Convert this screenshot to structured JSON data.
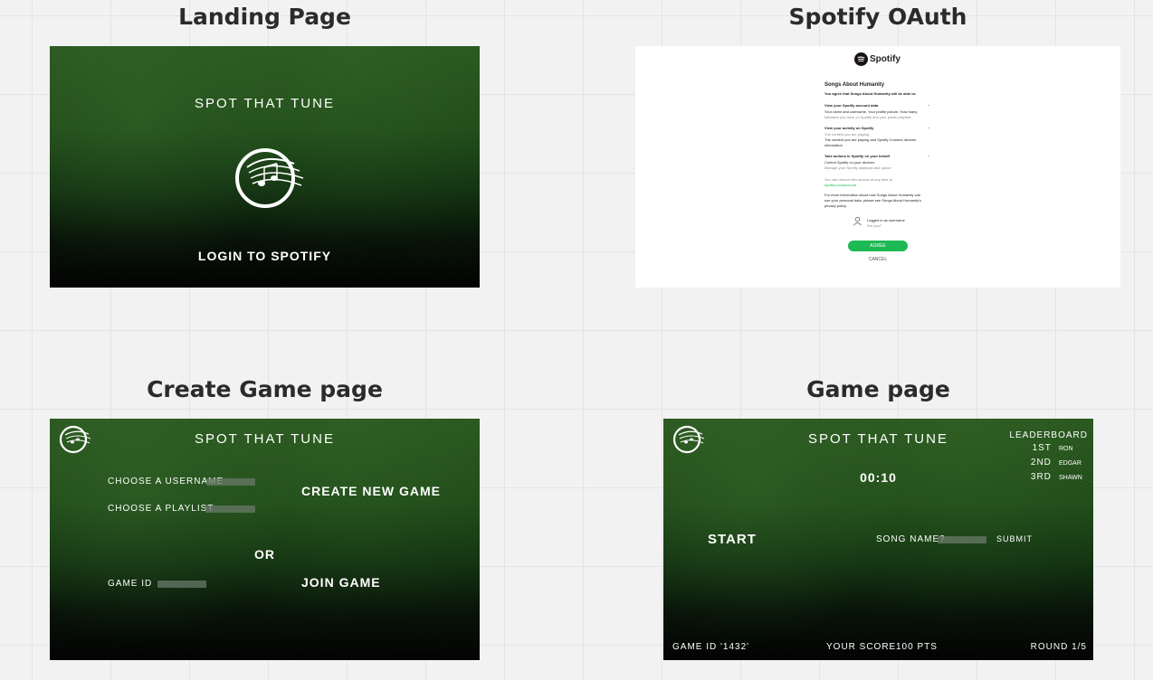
{
  "frames": {
    "landing": {
      "title": "Landing Page",
      "brand": "SPOT THAT TUNE",
      "login": "LOGIN TO SPOTIFY"
    },
    "oauth": {
      "title": "Spotify OAuth",
      "brand": "Spotify",
      "app_name": "Songs About Humanity",
      "intro": "You agree that Songs About Humanity will be able to:",
      "section1_title": "View your Spotify account data",
      "section1_l1": "Your name and username, Your profile picture, How many",
      "section1_l2": "followers you have on Spotify and your public playlists",
      "section2_title": "View your activity on Spotify",
      "section2_l1": "The content you are playing",
      "section2_l2": "The content you are playing and Spotify Connect devices",
      "section2_l3": "information",
      "section3_title": "Take actions in Spotify on your behalf",
      "section3_l1": "Control Spotify on your devices",
      "section3_l2": "Manage your Spotify playback and queue",
      "remove_l1": "You can remove this access at any time at",
      "remove_link": "spotify.com/account",
      "more_l1": "For more information about how Songs About Humanity can",
      "more_l2": "use your personal data, please see Songs About Humanity's",
      "more_l3": "privacy policy.",
      "logged_in": "Logged in as username",
      "not_you": "Not you?",
      "agree": "AGREE",
      "cancel": "CANCEL"
    },
    "create": {
      "title": "Create Game page",
      "brand": "SPOT THAT TUNE",
      "username_label": "CHOOSE A USERNAME",
      "playlist_label": "CHOOSE A PLAYLIST",
      "create_btn": "CREATE NEW GAME",
      "or": "OR",
      "game_id_label": "GAME ID",
      "join_btn": "JOIN GAME"
    },
    "game": {
      "title": "Game page",
      "brand": "SPOT THAT TUNE",
      "leaderboard_title": "LEADERBOARD",
      "lb1_place": "1ST",
      "lb1_name": "RON",
      "lb2_place": "2ND",
      "lb2_name": "EDGAR",
      "lb3_place": "3RD",
      "lb3_name": "SHAWN",
      "timer": "00:10",
      "start": "START",
      "song_label": "SONG NAME?",
      "submit": "SUBMIT",
      "game_id": "GAME ID '1432'",
      "score_label": "YOUR SCORE",
      "score_value": "100 PTS",
      "round": "ROUND 1/5"
    }
  },
  "colors": {
    "canvas": "#f2f2f2",
    "title_text": "#2b2b2b",
    "spotify_green": "#1db954",
    "screen_text": "#ffffff"
  }
}
